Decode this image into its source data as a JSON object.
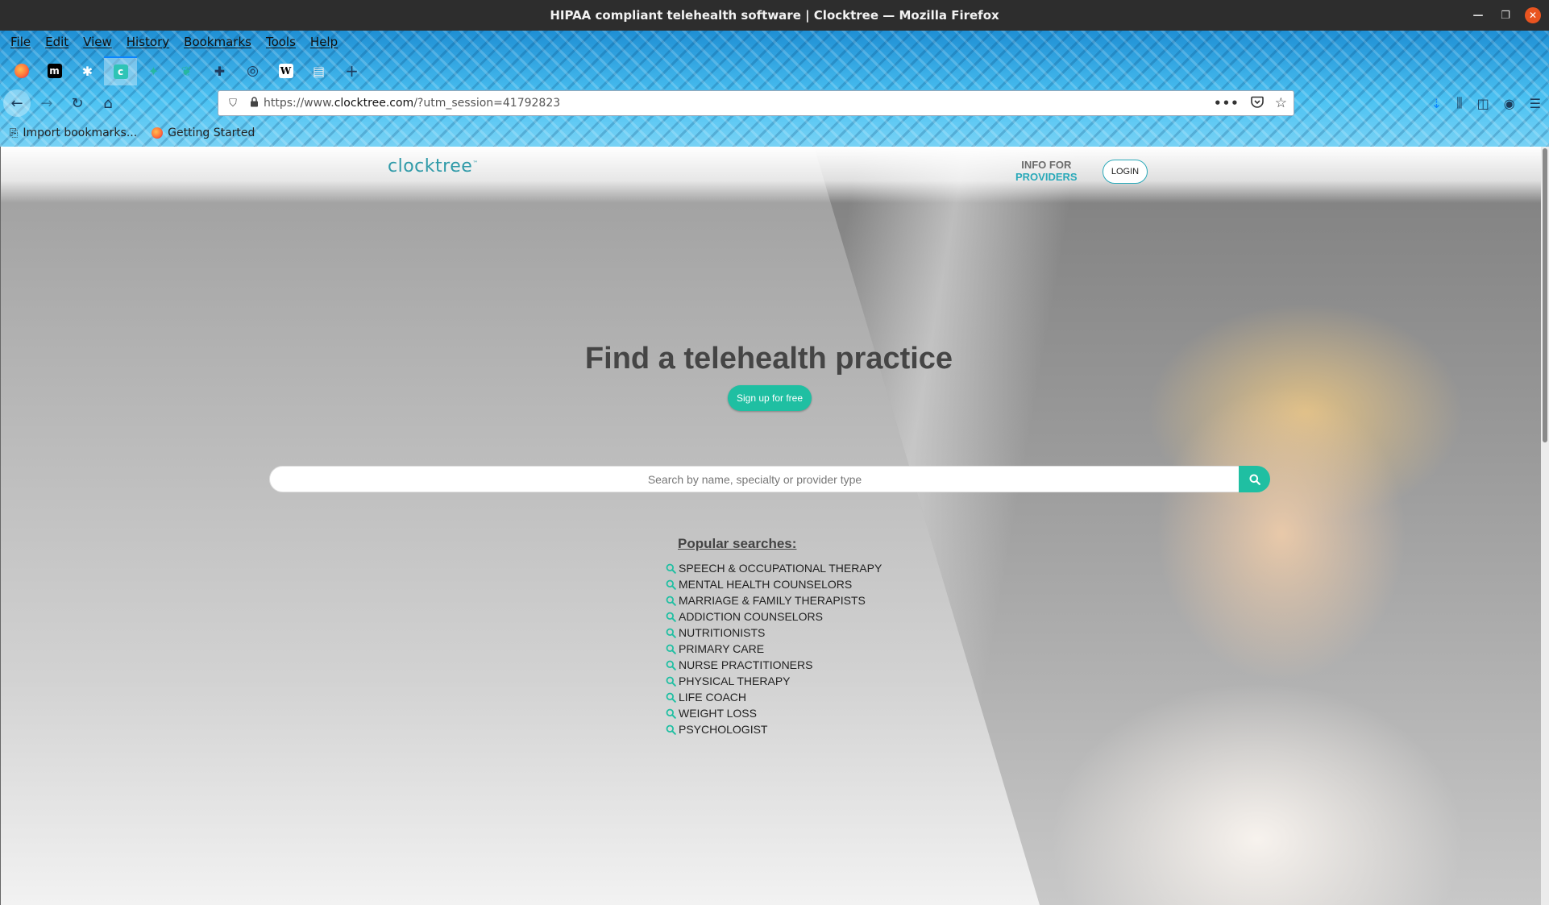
{
  "window": {
    "title": "HIPAA compliant telehealth software | Clocktree — Mozilla Firefox"
  },
  "menu": [
    "File",
    "Edit",
    "View",
    "History",
    "Bookmarks",
    "Tools",
    "Help"
  ],
  "tabs": [
    {
      "icon": "firefox-icon",
      "color": "#ff7139"
    },
    {
      "icon": "m-icon",
      "glyph": "m",
      "color": "#000000"
    },
    {
      "icon": "gear-icon",
      "glyph": "✱",
      "color": "#2a86d0"
    },
    {
      "icon": "clocktree-icon",
      "glyph": "c",
      "color": "#2ec4b6",
      "active": true
    },
    {
      "icon": "leaf-icon",
      "glyph": "✦",
      "color": "#26b7a0"
    },
    {
      "icon": "leaf-icon",
      "glyph": "❦",
      "color": "#26b7a0"
    },
    {
      "icon": "puzzle-icon",
      "glyph": "✚",
      "color": "#2b4a6f"
    },
    {
      "icon": "globe-icon",
      "glyph": "◎",
      "color": "#2b4a6f"
    },
    {
      "icon": "wikipedia-icon",
      "glyph": "W",
      "color": "#ffffff"
    },
    {
      "icon": "reader-icon",
      "glyph": "▤",
      "color": "#d9d9d9"
    }
  ],
  "newtab_label": "+",
  "url": {
    "prefix": "https://www.",
    "domain": "clocktree.com",
    "suffix": "/?utm_session=41792823"
  },
  "bookmarks": [
    {
      "label": "Import bookmarks...",
      "icon": "import-icon"
    },
    {
      "label": "Getting Started",
      "icon": "firefox-icon"
    }
  ],
  "site": {
    "logo": "clocktree",
    "logo_tm": "™",
    "info_for_line1": "INFO FOR",
    "info_for_line2": "PROVIDERS",
    "login_label": "LOGIN",
    "hero_title": "Find a telehealth practice",
    "signup_label": "Sign up for free",
    "search_placeholder": "Search by name, specialty or provider type",
    "popular_title": "Popular searches:",
    "popular_items": [
      "SPEECH & OCCUPATIONAL THERAPY",
      "MENTAL HEALTH COUNSELORS",
      "MARRIAGE & FAMILY THERAPISTS",
      "ADDICTION COUNSELORS",
      "NUTRITIONISTS",
      "PRIMARY CARE",
      "NURSE PRACTITIONERS",
      "PHYSICAL THERAPY",
      "LIFE COACH",
      "WEIGHT LOSS",
      "PSYCHOLOGIST"
    ]
  },
  "colors": {
    "accent": "#1fbfa2",
    "brand": "#2f9aa8"
  }
}
